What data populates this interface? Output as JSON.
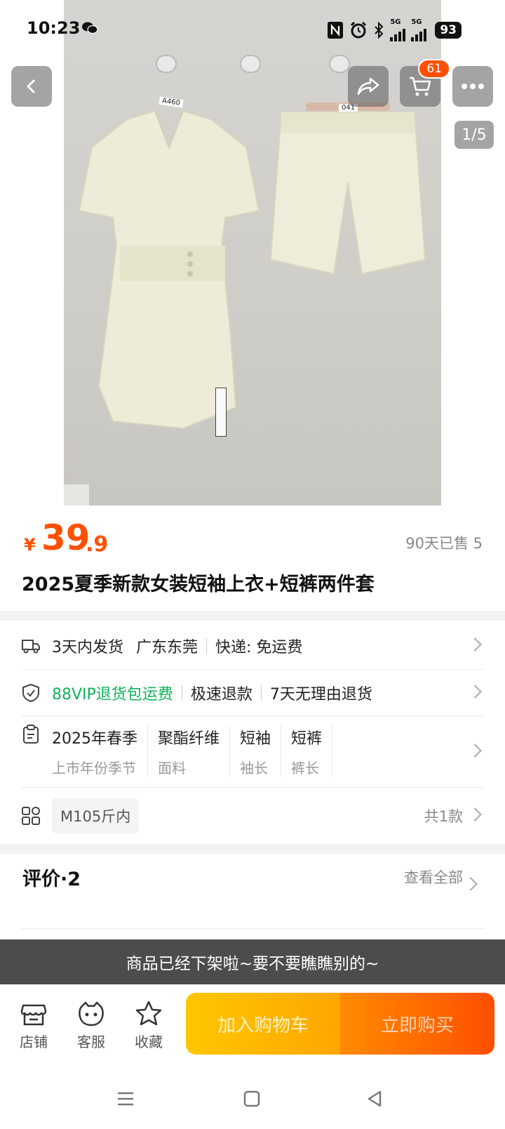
{
  "status_bar": {
    "time": "10:23",
    "network_1": "5G",
    "network_2": "5G",
    "battery": "93"
  },
  "gallery": {
    "page_indicator": "1/5",
    "cart_badge": "61",
    "hanger_tag_top": "A460",
    "hanger_tag_bottoms": "041"
  },
  "price": {
    "currency": "¥",
    "integer": "39",
    "decimal": ".9",
    "sold": "90天已售 5"
  },
  "product_title": "2025夏季新款女装短袖上衣+短裤两件套",
  "shipping": {
    "delivery": "3天内发货",
    "location": "广东东莞",
    "express": "快递: 免运费"
  },
  "guarantee": {
    "vip": "88VIP退货包运费",
    "refund": "极速退款",
    "return": "7天无理由退货"
  },
  "attributes": [
    {
      "value": "2025年春季",
      "label": "上市年份季节"
    },
    {
      "value": "聚酯纤维",
      "label": "面料"
    },
    {
      "value": "短袖",
      "label": "袖长"
    },
    {
      "value": "短裤",
      "label": "裤长"
    }
  ],
  "sku": {
    "chip": "M105斤内",
    "count": "共1款"
  },
  "reviews": {
    "title": "评价·2",
    "see_all": "查看全部"
  },
  "toast": "商品已经下架啦~要不要瞧瞧别的~",
  "bottom_bar": {
    "shop": "店铺",
    "service": "客服",
    "favorite": "收藏",
    "add_to_cart": "加入购物车",
    "buy_now": "立即购买"
  },
  "colors": {
    "accent": "#ff5000",
    "green": "#10b25a"
  }
}
